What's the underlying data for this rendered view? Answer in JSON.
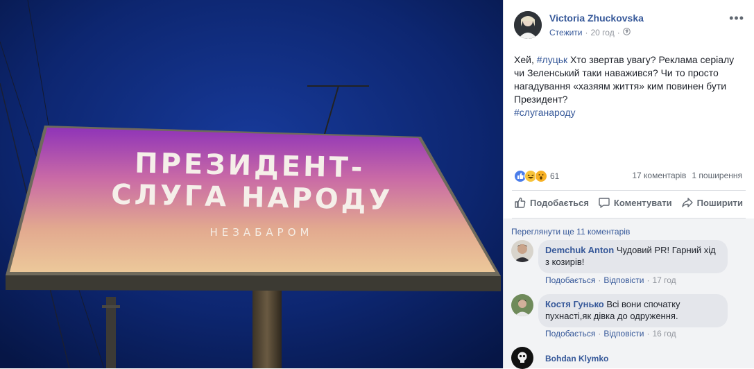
{
  "photo": {
    "billboard_line1": "ПРЕЗИДЕНТ-",
    "billboard_line2": "СЛУГА НАРОДУ",
    "billboard_sub": "НЕЗАБАРОМ"
  },
  "post": {
    "author": "Victoria Zhuckovska",
    "follow_label": "Стежити",
    "time": "20 год",
    "privacy_icon": "globe-icon",
    "more_label": "•••",
    "text_prefix": "Хей, ",
    "hashtag1": "#луцьк",
    "text_body": " Хто звертав увагу? Реклама серіалу чи Зеленський таки наважився? Чи то просто нагадування «хазяям життя» ким повинен бути Президент?",
    "hashtag2": "#слуганароду"
  },
  "stats": {
    "reaction_icons": [
      "like-icon",
      "haha-icon",
      "wow-icon"
    ],
    "reaction_count": "61",
    "comments_count": "17 коментарів",
    "shares_count": "1 поширення"
  },
  "actions": {
    "like_label": "Подобається",
    "comment_label": "Коментувати",
    "share_label": "Поширити"
  },
  "comments": {
    "view_more": "Переглянути ще 11 коментарів",
    "items": [
      {
        "name": "Demchuk Anton",
        "text": "Чудовий PR! Гарний хід з козирів!",
        "like": "Подобається",
        "reply": "Відповісти",
        "time": "17 год"
      },
      {
        "name": "Костя Гунько",
        "text": "Всі вони спочатку пухнасті,як дівка до одруження.",
        "like": "Подобається",
        "reply": "Відповісти",
        "time": "16 год"
      },
      {
        "name": "Bohdan Klymko"
      }
    ],
    "separator": "·"
  },
  "colors": {
    "link_blue": "#365899",
    "sky": "#0a1f5c",
    "billboard_top": "#8a2fb0",
    "billboard_bottom": "#e8c79a"
  }
}
